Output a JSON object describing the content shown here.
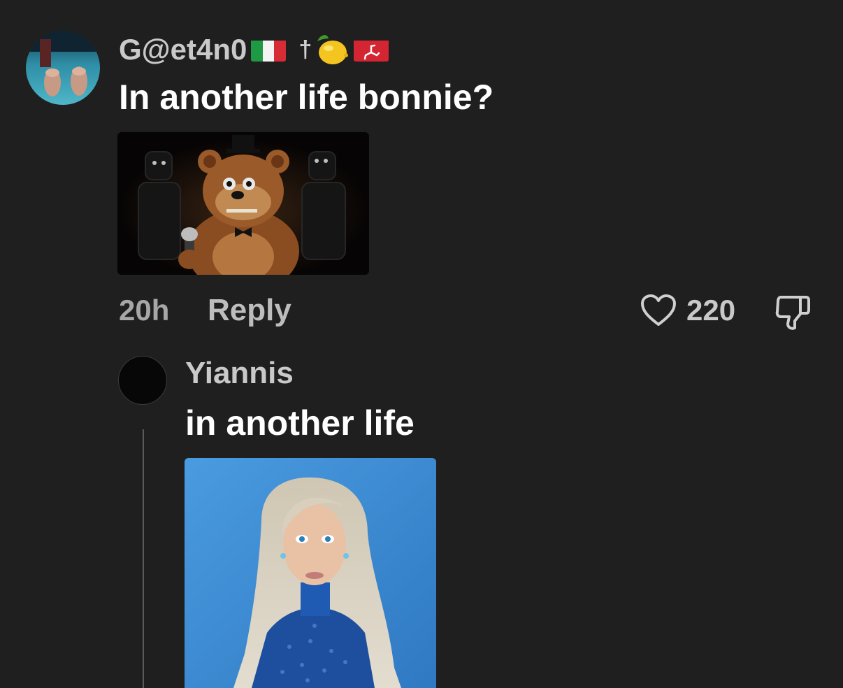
{
  "comment": {
    "username": "G@et4n0",
    "username_decorations": [
      "italy-flag",
      "cross",
      "lemon",
      "isle-of-man-flag"
    ],
    "cross_glyph": "†",
    "text": "In another life bonnie?",
    "media": "freddy-fazbear-image",
    "time": "20h",
    "reply_label": "Reply",
    "like_count": "220"
  },
  "reply": {
    "username": "Yiannis",
    "text": "in another life",
    "media": "portrait-photo-blue-background"
  },
  "colors": {
    "background": "#1f1f1f",
    "primary_text": "#ffffff",
    "secondary_text": "#a7a7a7",
    "thread_line": "#5a5a5a"
  }
}
